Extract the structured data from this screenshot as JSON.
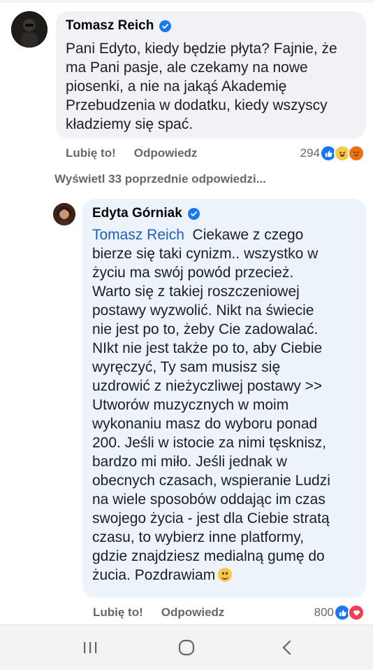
{
  "comment": {
    "author": "Tomasz Reich",
    "lines": [
      "Pani Edyto, kiedy będzie płyta? Fajnie, że",
      "ma Pani pasje, ale czekamy na nowe",
      "piosenki, a nie na jakąś Akademię",
      "Przebudzenia w dodatku, kiedy wszyscy",
      "kładziemy się spać."
    ],
    "like_label": "Lubię to!",
    "reply_label": "Odpowiedz",
    "reaction_count": "294",
    "reaction_icons": [
      "like-icon",
      "haha-icon",
      "angry-icon"
    ]
  },
  "view_more": "Wyświetl 33 poprzednie odpowiedzi...",
  "reply": {
    "author": "Edyta Górniak",
    "mention": "Tomasz Reich",
    "first_line_rest": "  Ciekawe z czego",
    "lines": [
      "bierze się taki cynizm.. wszystko w",
      "życiu ma swój powód przecież.",
      "Warto się z takiej roszczeniowej",
      "postawy wyzwolić. Nikt na świecie",
      "nie jest po to, żeby Cie zadowalać.",
      "NIkt nie jest także po to, aby Ciebie",
      "wyręczyć, Ty sam musisz się",
      "uzdrowić z nieżyczliwej postawy >>",
      "Utworów muzycznych w moim",
      "wykonaniu masz do wyboru ponad",
      "200. Jeśli w istocie za nimi tęsknisz,",
      "bardzo mi miło. Jeśli jednak w",
      "obecnych czasach, wspieranie Ludzi",
      "na wiele sposobów oddając im czas",
      "swojego życia - jest dla Ciebie stratą",
      "czasu, to wybierz inne platformy,",
      "gdzie znajdziesz medialną gumę do"
    ],
    "last_line": "żucia. Pozdrawiam",
    "like_label": "Lubię to!",
    "reply_label": "Odpowiedz",
    "reaction_count": "800",
    "reaction_icons": [
      "like-icon",
      "love-icon"
    ]
  },
  "colors": {
    "bubble": "#f0f2f5",
    "meta": "#65676b",
    "mention": "#1f5fb5",
    "verified": "#1877f2"
  }
}
